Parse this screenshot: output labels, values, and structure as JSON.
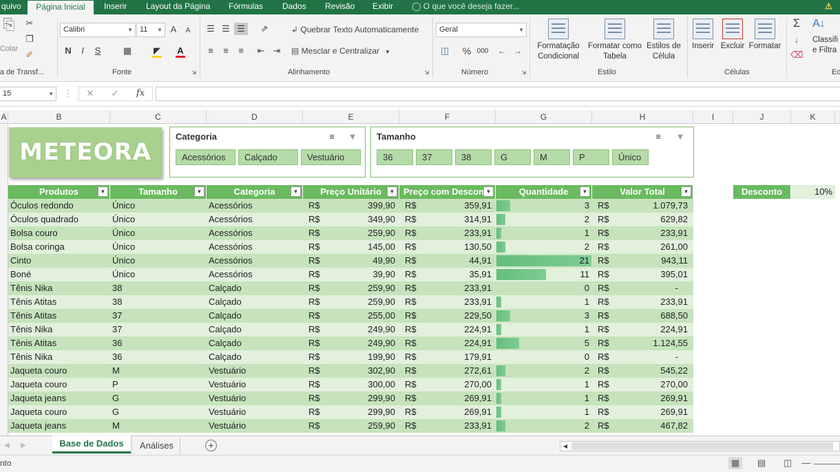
{
  "menu": {
    "tabs": [
      "quivo",
      "Página Inicial",
      "Inserir",
      "Layout da Página",
      "Fórmulas",
      "Dados",
      "Revisão",
      "Exibir"
    ],
    "tell_me": "O que você deseja fazer...",
    "active_tab": "Página Inicial"
  },
  "ribbon": {
    "clipboard": {
      "paste_label": "Colar",
      "group_label": "a de Transf..."
    },
    "font": {
      "name": "Calibri",
      "size": "11",
      "bold": "N",
      "italic": "I",
      "underline": "S",
      "grow": "A",
      "shrink": "A",
      "group_label": "Fonte"
    },
    "alignment": {
      "wrap_text": "Quebrar Texto Automaticamente",
      "merge_center": "Mesclar e Centralizar",
      "group_label": "Alinhamento"
    },
    "number": {
      "format": "Geral",
      "percent": "%",
      "thousands": "000",
      "inc_decimal": ",0→,00",
      "dec_decimal": ",00→,0",
      "group_label": "Número"
    },
    "styles": {
      "conditional": "Formatação Condicional",
      "format_table": "Formatar como Tabela",
      "cell_styles": "Estilos de Célula",
      "group_label": "Estilo"
    },
    "cells": {
      "insert": "Inserir",
      "delete": "Excluir",
      "format": "Formatar",
      "group_label": "Células"
    },
    "editing": {
      "sum": "Σ",
      "sort": "Classifi e Filtra",
      "group_label": "Ed"
    }
  },
  "formula_bar": {
    "name_box": "15",
    "cancel": "✕",
    "enter": "✓",
    "fx": "fx",
    "value": ""
  },
  "columns": [
    "A",
    "B",
    "C",
    "D",
    "E",
    "F",
    "G",
    "H",
    "I",
    "J",
    "K"
  ],
  "logo": "METEORA",
  "slicers": {
    "categoria": {
      "title": "Categoria",
      "items": [
        "Acessórios",
        "Calçado",
        "Vestuário"
      ]
    },
    "tamanho": {
      "title": "Tamanho",
      "items": [
        "36",
        "37",
        "38",
        "G",
        "M",
        "P",
        "Único"
      ]
    }
  },
  "table": {
    "headers": [
      "Produtos",
      "Tamanho",
      "Categoria",
      "Preço Unitário",
      "Preço com Desconto",
      "Quantidade",
      "Valor Total"
    ],
    "currency": "R$",
    "rows": [
      {
        "produto": "Óculos redondo",
        "tamanho": "Único",
        "categoria": "Acessórios",
        "preco": "399,90",
        "desconto": "359,91",
        "qtd": "3",
        "total": "1.079,73",
        "qtd_fill": 0.143
      },
      {
        "produto": "Óculos quadrado",
        "tamanho": "Único",
        "categoria": "Acessórios",
        "preco": "349,90",
        "desconto": "314,91",
        "qtd": "2",
        "total": "629,82",
        "qtd_fill": 0.095
      },
      {
        "produto": "Bolsa couro",
        "tamanho": "Único",
        "categoria": "Acessórios",
        "preco": "259,90",
        "desconto": "233,91",
        "qtd": "1",
        "total": "233,91",
        "qtd_fill": 0.048
      },
      {
        "produto": "Bolsa coringa",
        "tamanho": "Único",
        "categoria": "Acessórios",
        "preco": "145,00",
        "desconto": "130,50",
        "qtd": "2",
        "total": "261,00",
        "qtd_fill": 0.095
      },
      {
        "produto": "Cinto",
        "tamanho": "Único",
        "categoria": "Acessórios",
        "preco": "49,90",
        "desconto": "44,91",
        "qtd": "21",
        "total": "943,11",
        "qtd_fill": 1.0
      },
      {
        "produto": "Boné",
        "tamanho": "Único",
        "categoria": "Acessórios",
        "preco": "39,90",
        "desconto": "35,91",
        "qtd": "11",
        "total": "395,01",
        "qtd_fill": 0.524
      },
      {
        "produto": "Tênis Nika",
        "tamanho": "38",
        "categoria": "Calçado",
        "preco": "259,90",
        "desconto": "233,91",
        "qtd": "0",
        "total": "-",
        "qtd_fill": 0
      },
      {
        "produto": "Tênis Atitas",
        "tamanho": "38",
        "categoria": "Calçado",
        "preco": "259,90",
        "desconto": "233,91",
        "qtd": "1",
        "total": "233,91",
        "qtd_fill": 0.048
      },
      {
        "produto": "Tênis Atitas",
        "tamanho": "37",
        "categoria": "Calçado",
        "preco": "255,00",
        "desconto": "229,50",
        "qtd": "3",
        "total": "688,50",
        "qtd_fill": 0.143
      },
      {
        "produto": "Tênis Nika",
        "tamanho": "37",
        "categoria": "Calçado",
        "preco": "249,90",
        "desconto": "224,91",
        "qtd": "1",
        "total": "224,91",
        "qtd_fill": 0.048
      },
      {
        "produto": "Tênis Atitas",
        "tamanho": "36",
        "categoria": "Calçado",
        "preco": "249,90",
        "desconto": "224,91",
        "qtd": "5",
        "total": "1.124,55",
        "qtd_fill": 0.238
      },
      {
        "produto": "Tênis Nika",
        "tamanho": "36",
        "categoria": "Calçado",
        "preco": "199,90",
        "desconto": "179,91",
        "qtd": "0",
        "total": "-",
        "qtd_fill": 0
      },
      {
        "produto": "Jaqueta couro",
        "tamanho": "M",
        "categoria": "Vestuário",
        "preco": "302,90",
        "desconto": "272,61",
        "qtd": "2",
        "total": "545,22",
        "qtd_fill": 0.095
      },
      {
        "produto": "Jaqueta couro",
        "tamanho": "P",
        "categoria": "Vestuário",
        "preco": "300,00",
        "desconto": "270,00",
        "qtd": "1",
        "total": "270,00",
        "qtd_fill": 0.048
      },
      {
        "produto": "Jaqueta jeans",
        "tamanho": "G",
        "categoria": "Vestuário",
        "preco": "299,90",
        "desconto": "269,91",
        "qtd": "1",
        "total": "269,91",
        "qtd_fill": 0.048
      },
      {
        "produto": "Jaqueta couro",
        "tamanho": "G",
        "categoria": "Vestuário",
        "preco": "299,90",
        "desconto": "269,91",
        "qtd": "1",
        "total": "269,91",
        "qtd_fill": 0.048
      },
      {
        "produto": "Jaqueta jeans",
        "tamanho": "M",
        "categoria": "Vestuário",
        "preco": "259,90",
        "desconto": "233,91",
        "qtd": "2",
        "total": "467,82",
        "qtd_fill": 0.095
      }
    ]
  },
  "discount": {
    "label": "Desconto",
    "value": "10%"
  },
  "sheets": {
    "tabs": [
      "Base de Dados",
      "Análises"
    ],
    "active": "Base de Dados",
    "add": "+"
  },
  "status": {
    "text": "nto"
  },
  "colors": {
    "excel_green": "#217346",
    "header_green": "#6aba5f",
    "band_dark": "#c6e3bc",
    "band_light": "#e2f0dc",
    "databar": "#63be7b"
  }
}
